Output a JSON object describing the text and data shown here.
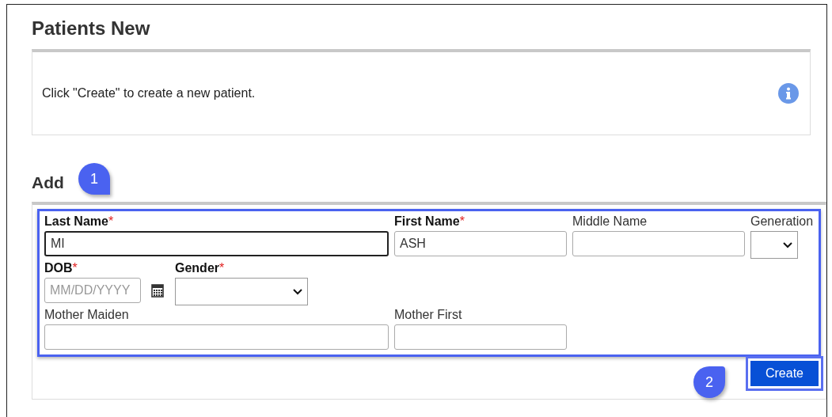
{
  "page": {
    "title": "Patients New"
  },
  "info": {
    "message": "Click \"Create\" to create a new patient."
  },
  "add_section": {
    "heading": "Add",
    "rows": [
      [
        {
          "kind": "text",
          "label": "Last Name",
          "required": true,
          "value": "MI",
          "focused": true
        },
        {
          "kind": "text",
          "label": "First Name",
          "required": true,
          "value": "ASH",
          "focused": false
        },
        {
          "kind": "text",
          "label": "Middle Name",
          "required": false,
          "focused": false
        },
        {
          "kind": "select",
          "label": "Generation",
          "required": false
        }
      ],
      [
        {
          "kind": "date",
          "label": "DOB",
          "required": true,
          "placeholder": "MM/DD/YYYY",
          "focused": false
        },
        {
          "kind": "select",
          "label": "Gender",
          "required": true
        }
      ],
      [
        {
          "kind": "text",
          "label": "Mother Maiden",
          "required": false,
          "focused": false
        },
        {
          "kind": "text",
          "label": "Mother First",
          "required": false,
          "focused": false
        }
      ]
    ],
    "required_mark": "*",
    "create_button": "Create"
  },
  "callouts": [
    {
      "label": "1"
    },
    {
      "label": "2"
    }
  ]
}
